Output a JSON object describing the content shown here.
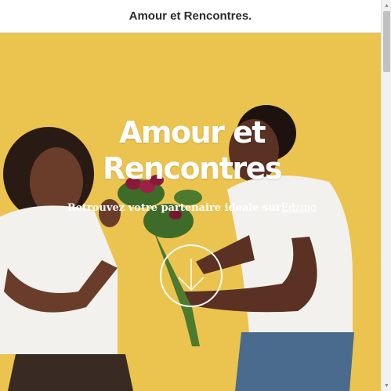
{
  "header": {
    "title": "Amour et Rencontres."
  },
  "hero": {
    "heading_line1": "Amour et",
    "heading_line2": "Rencontres",
    "subtitle": "Retrouvez votre partenaire ideale sur",
    "subtitle_link": "Edzing",
    "scroll_icon": "arrow-down-icon"
  },
  "colors": {
    "hero_background": "#e9c14c",
    "heading_text": "#ffffff",
    "topbar_text": "#2b2b2b",
    "shirt_white": "#f2f1ee",
    "skin": "#6a3d2a",
    "roses": "#8b1a3a",
    "leaves": "#3f6b2a",
    "jeans": "#4a6a8e"
  },
  "scrollbar": {
    "up_icon": "scroll-up-arrow-icon",
    "down_icon": "scroll-down-arrow-icon"
  }
}
